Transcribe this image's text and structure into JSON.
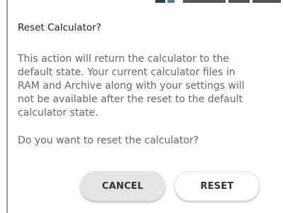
{
  "dialog": {
    "title": "Reset Calculator?",
    "message": "This action will return the calculator to the default state. Your current calculator files in RAM and Archive along with your settings will not be available after the reset to the default calculator state.",
    "question": "Do you want to reset the calculator?",
    "cancel_label": "CANCEL",
    "reset_label": "RESET"
  }
}
